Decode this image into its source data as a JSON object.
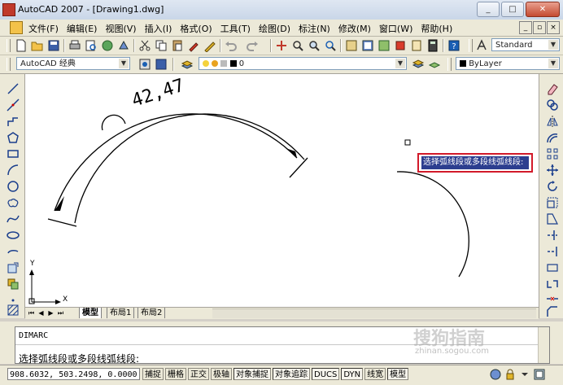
{
  "window": {
    "title": "AutoCAD 2007 - [Drawing1.dwg]",
    "min": "_",
    "max": "□",
    "close": "✕"
  },
  "menu": {
    "items": [
      "文件(F)",
      "编辑(E)",
      "视图(V)",
      "插入(I)",
      "格式(O)",
      "工具(T)",
      "绘图(D)",
      "标注(N)",
      "修改(M)",
      "窗口(W)",
      "帮助(H)"
    ],
    "doc_min": "_",
    "doc_restore": "▫",
    "doc_close": "×"
  },
  "toolbar1": {
    "text_style": "Standard"
  },
  "toolbar2": {
    "workspace": "AutoCAD 经典",
    "layer": "0",
    "color": "ByLayer"
  },
  "drawing": {
    "dimension_text": "42,47"
  },
  "prompt": {
    "text": "选择弧线段或多段线弧线段:"
  },
  "ucs": {
    "x": "X",
    "y": "Y"
  },
  "layout_tabs": {
    "nav": [
      "⏮",
      "◀",
      "▶",
      "⏭"
    ],
    "tabs": [
      "模型",
      "布局1",
      "布局2"
    ]
  },
  "command": {
    "line1": "DIMARC",
    "line2": "选择弧线段或多段线弧线段:"
  },
  "status": {
    "coords": "908.6032, 503.2498, 0.0000",
    "buttons": [
      "捕捉",
      "栅格",
      "正交",
      "极轴",
      "对象捕捉",
      "对象追踪",
      "DUCS",
      "DYN",
      "线宽",
      "模型"
    ]
  },
  "watermark": {
    "line1": "搜狗指南",
    "line2": "zhinan.sogou.com"
  },
  "colors": {
    "prompt_border": "#d21a2a",
    "prompt_bg": "#2c3e8f"
  }
}
